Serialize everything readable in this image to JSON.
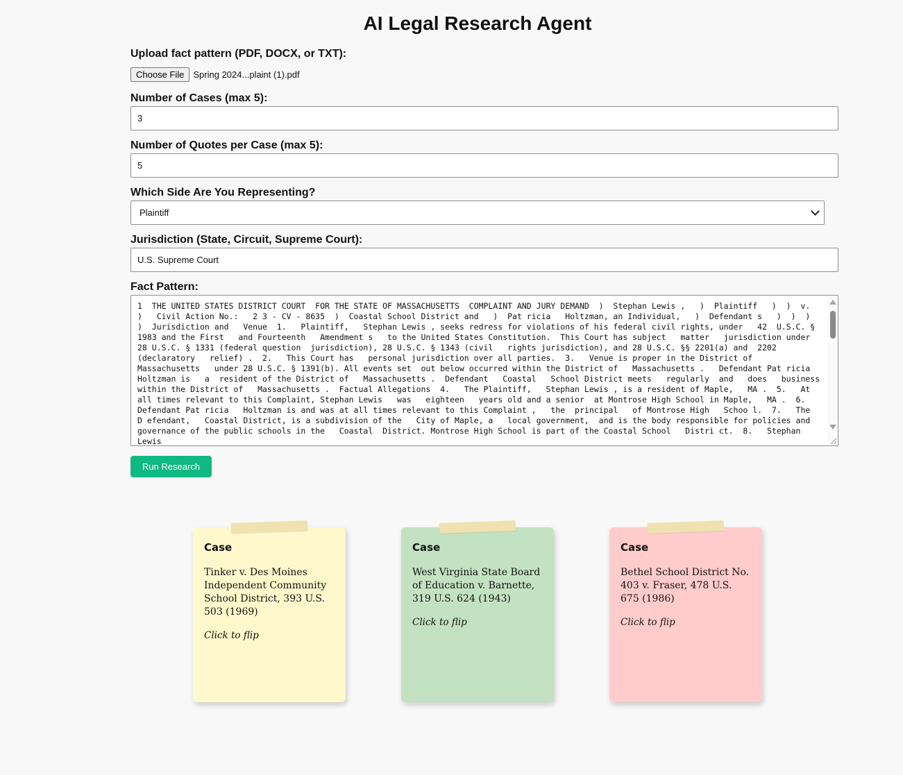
{
  "header": {
    "title": "AI Legal Research Agent"
  },
  "form": {
    "upload": {
      "label": "Upload fact pattern (PDF, DOCX, or TXT):",
      "button_label": "Choose File",
      "file_name": "Spring 2024...plaint (1).pdf"
    },
    "num_cases": {
      "label": "Number of Cases (max 5):",
      "value": "3"
    },
    "num_quotes": {
      "label": "Number of Quotes per Case (max 5):",
      "value": "5"
    },
    "side": {
      "label": "Which Side Are You Representing?",
      "selected": "Plaintiff"
    },
    "jurisdiction": {
      "label": "Jurisdiction (State, Circuit, Supreme Court):",
      "value": "U.S. Supreme Court"
    },
    "fact_pattern": {
      "label": "Fact Pattern:",
      "value": "1  THE UNITED STATES DISTRICT COURT  FOR THE STATE OF MASSACHUSETTS  COMPLAINT AND JURY DEMAND  )  Stephan Lewis ,   )  Plaintiff   )  )  v.   )   Civil Action No.:   2 3 - CV - 8635  )  Coastal School District and   )  Pat ricia   Holtzman, an Individual,   )  Defendant s   )  )  )  )  Jurisdiction and   Venue  1.   Plaintiff,   Stephan Lewis , seeks redress for violations of his federal civil rights, under   42  U.S.C. § 1983 and the First   and Fourteenth   Amendment s   to the United States Constitution.  This Court has subject   matter   jurisdiction under 28 U.S.C. § 1331 (federal question  jurisdiction), 28 U.S.C. § 1343 (civil   rights jurisdiction), and 28 U.S.C. §§ 2201(a) and  2202 (declaratory   relief) .  2.   This Court has   personal jurisdiction over all parties.  3.   Venue is proper in the District of   Massachusetts   under 28 U.S.C. § 1391(b). All events set  out below occurred within the District of   Massachusetts .   Defendant Pat ricia   Holtzman is   a  resident of the District of   Massachusetts .  Defendant   Coastal   School District meets   regularly  and   does   business within the District of   Massachusetts .  Factual Allegations  4.   The Plaintiff,   Stephan Lewis , is a resident of Maple,   MA .  5.   At all times relevant to this Complaint, Stephan Lewis   was   eighteen   years old and a senior  at Montrose High School in Maple,   MA .  6.   Defendant Pat ricia   Holtzman is and was at all times relevant to this Complaint ,   the  principal   of Montrose High   Schoo l.  7.   The   D efendant,   Coastal District, is a subdivision of the   City of Maple, a   local government,  and is the body responsible for policies and governance of the public schools in the   Coastal  District. Montrose High School is part of the Coastal School   Distri ct.  8.   Stephan Lewis"
    },
    "run_button_label": "Run Research"
  },
  "results": {
    "cards": [
      {
        "title": "Case",
        "case_name": "Tinker v. Des Moines Independent Community School District, 393 U.S. 503 (1969)",
        "hint": "Click to flip",
        "color": "#fef8cc"
      },
      {
        "title": "Case",
        "case_name": "West Virginia State Board of Education v. Barnette, 319 U.S. 624 (1943)",
        "hint": "Click to flip",
        "color": "#c3e2c1"
      },
      {
        "title": "Case",
        "case_name": "Bethel School District No. 403 v. Fraser, 478 U.S. 675 (1986)",
        "hint": "Click to flip",
        "color": "#ffcccb"
      }
    ]
  },
  "colors": {
    "accent": "#10b981",
    "background": "#f8f8f8",
    "tape": "#efe2b0"
  }
}
